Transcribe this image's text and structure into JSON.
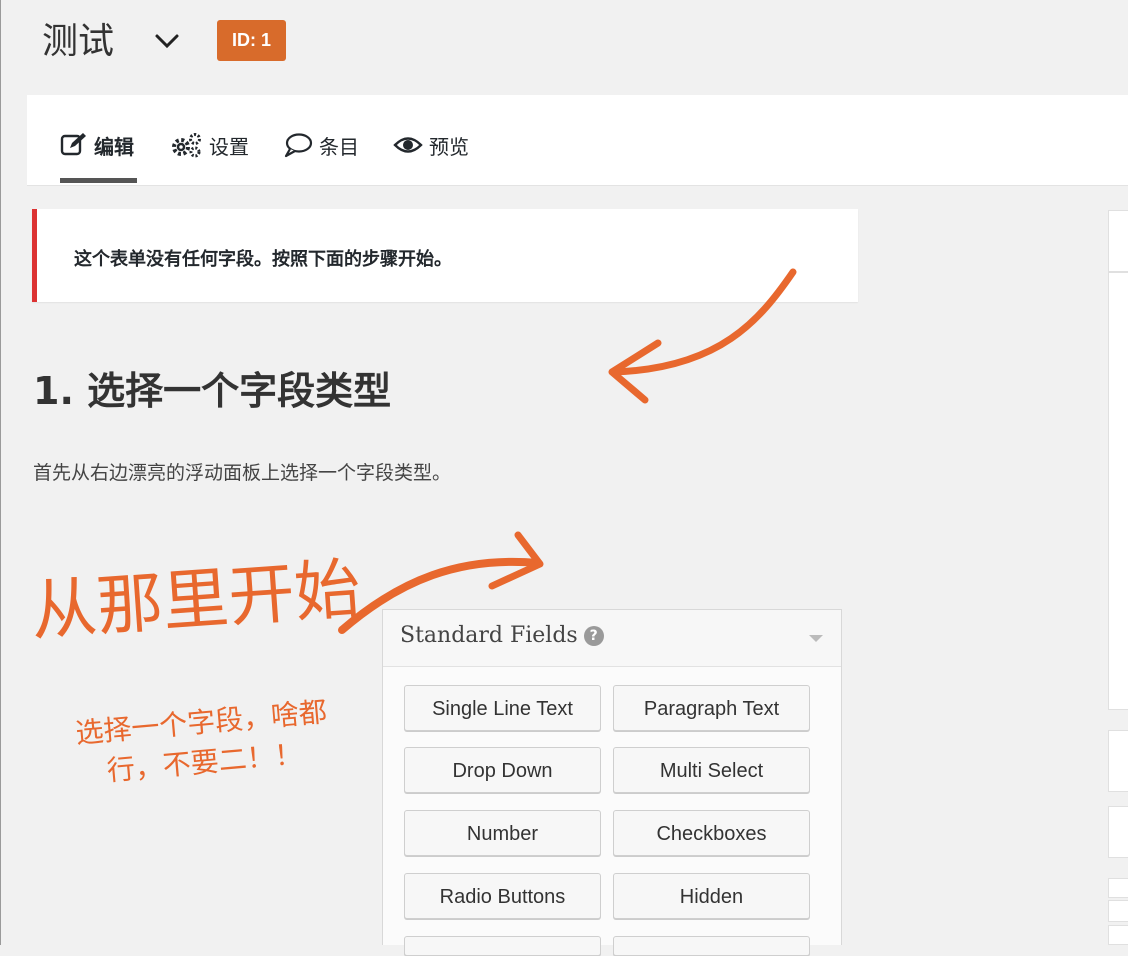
{
  "header": {
    "form_title": "测试",
    "id_badge": "ID: 1"
  },
  "tabs": [
    {
      "label": "编辑",
      "icon": "edit-icon",
      "active": true
    },
    {
      "label": "设置",
      "icon": "gears-icon",
      "active": false
    },
    {
      "label": "条目",
      "icon": "comment-icon",
      "active": false
    },
    {
      "label": "预览",
      "icon": "eye-icon",
      "active": false
    }
  ],
  "notice": {
    "text": "这个表单没有任何字段。按照下面的步骤开始。",
    "accent_color": "#dc3232"
  },
  "step": {
    "heading": "1. 选择一个字段类型",
    "description": "首先从右边漂亮的浮动面板上选择一个字段类型。"
  },
  "annotations": {
    "start_here": "从那里开始",
    "note_line1": "选择一个字段，啥都",
    "note_line2": "行，不要二！！",
    "color": "#e8682e"
  },
  "standard_fields": {
    "title": "Standard Fields",
    "help_glyph": "?",
    "buttons": [
      "Single Line Text",
      "Paragraph Text",
      "Drop Down",
      "Multi Select",
      "Number",
      "Checkboxes",
      "Radio Buttons",
      "Hidden"
    ]
  },
  "colors": {
    "badge": "#d86b2b",
    "background": "#f1f1f1"
  }
}
